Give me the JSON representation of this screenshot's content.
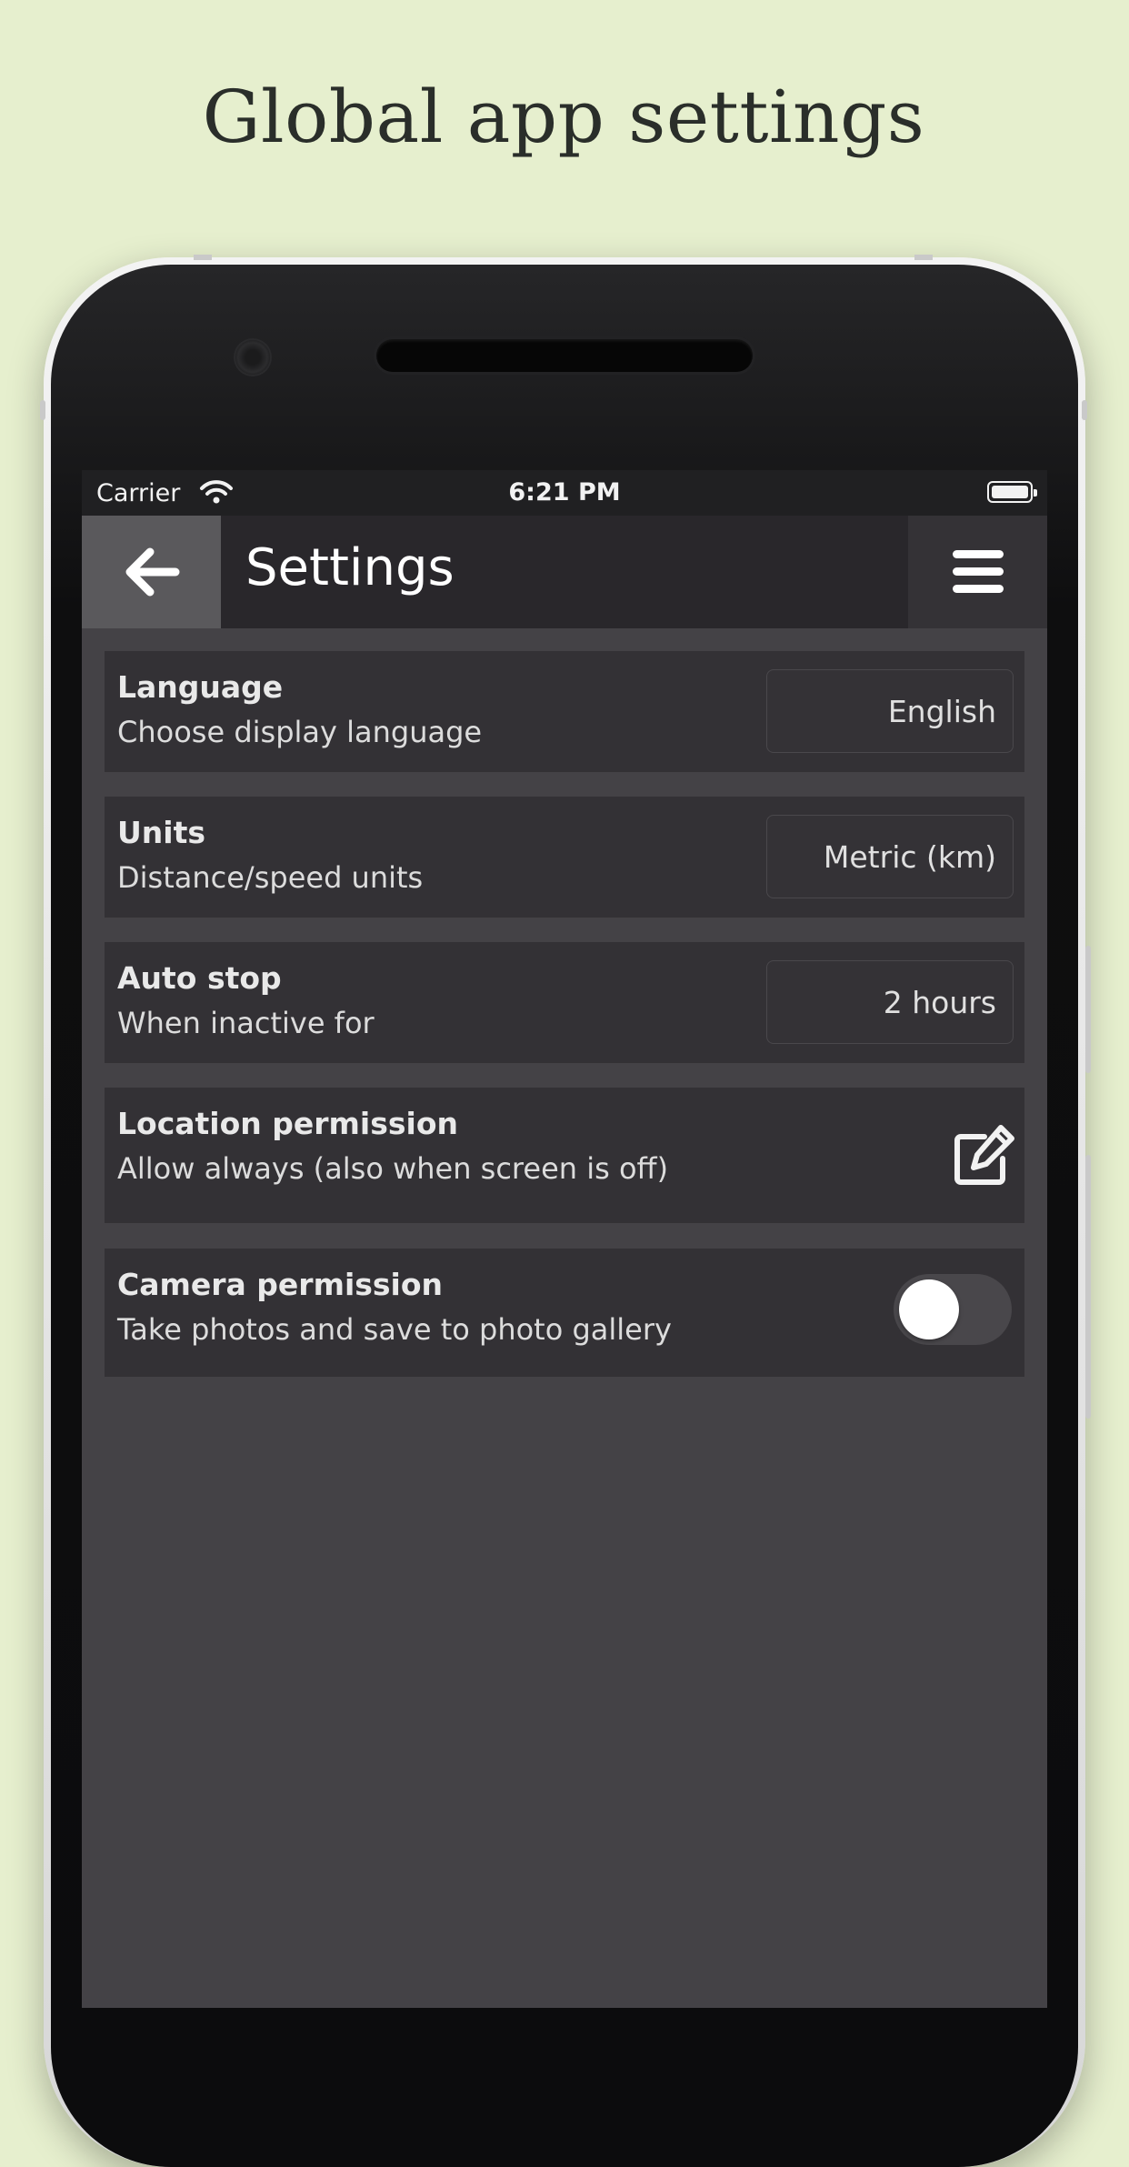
{
  "promo": {
    "headline": "Global app settings"
  },
  "status_bar": {
    "carrier": "Carrier",
    "time": "6:21 PM"
  },
  "app_bar": {
    "title": "Settings",
    "back_icon": "arrow-left-icon",
    "menu_icon": "hamburger-menu-icon"
  },
  "settings": [
    {
      "title": "Language",
      "subtitle": "Choose display language",
      "control": "select",
      "value": "English"
    },
    {
      "title": "Units",
      "subtitle": "Distance/speed units",
      "control": "select",
      "value": "Metric (km)"
    },
    {
      "title": "Auto stop",
      "subtitle": "When inactive for",
      "control": "select",
      "value": "2 hours"
    },
    {
      "title": "Location permission",
      "subtitle": "Allow always (also when screen is off)",
      "control": "edit",
      "icon": "edit-icon"
    },
    {
      "title": "Camera permission",
      "subtitle": "Take photos and save to photo gallery",
      "control": "toggle",
      "enabled": false
    }
  ],
  "colors": {
    "background": "#e6efce",
    "screen": "#444246",
    "app_bar": "#29272b",
    "row": "#333135"
  }
}
